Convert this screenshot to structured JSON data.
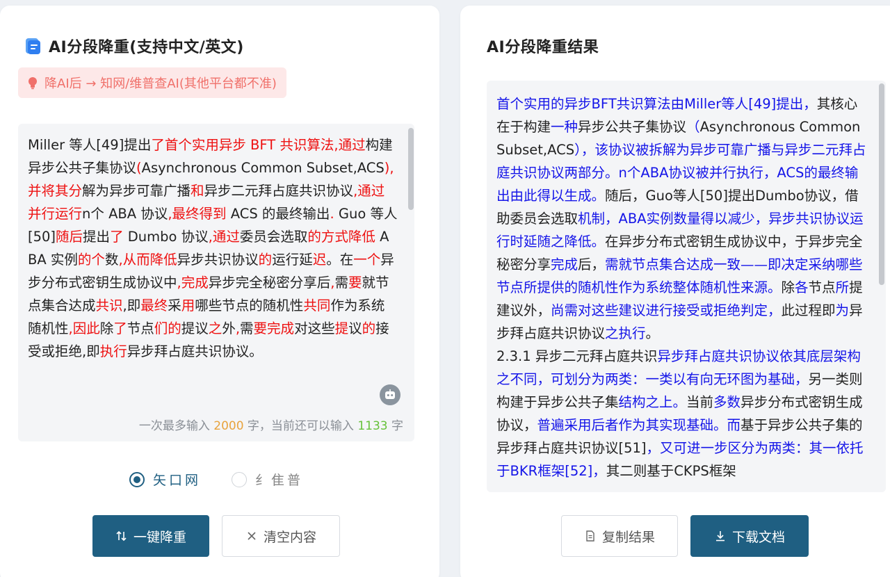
{
  "left": {
    "title": "AI分段降重(支持中文/英文)",
    "notice": "降AI后 → 知网/维普查AI(其他平台都不准)",
    "input_segments": [
      {
        "t": "Miller 等人[49]提出",
        "h": false
      },
      {
        "t": "了首个实用异步 BFT 共识算法,通过",
        "h": true
      },
      {
        "t": "构建异步公共子集协议",
        "h": false
      },
      {
        "t": "(",
        "h": true
      },
      {
        "t": "Asynchronous Common Subset,ACS",
        "h": false
      },
      {
        "t": "),并将其分",
        "h": true
      },
      {
        "t": "解为异步可靠广播",
        "h": false
      },
      {
        "t": "和",
        "h": true
      },
      {
        "t": "异步二元拜占庭共识协议",
        "h": false
      },
      {
        "t": ",通过并行运行",
        "h": true
      },
      {
        "t": "n个 ABA 协议",
        "h": false
      },
      {
        "t": ",最终得到",
        "h": true
      },
      {
        "t": " ACS 的最终输出",
        "h": false
      },
      {
        "t": ". ",
        "h": true
      },
      {
        "t": "Guo 等人[50]",
        "h": false
      },
      {
        "t": "随后",
        "h": true
      },
      {
        "t": "提出",
        "h": false
      },
      {
        "t": "了",
        "h": true
      },
      {
        "t": " Dumbo 协议",
        "h": false
      },
      {
        "t": ",通过",
        "h": true
      },
      {
        "t": "委员会选取",
        "h": false
      },
      {
        "t": "的方式降低",
        "h": true
      },
      {
        "t": " ABA 实例",
        "h": false
      },
      {
        "t": "的个",
        "h": true
      },
      {
        "t": "数",
        "h": false
      },
      {
        "t": ",从而降低",
        "h": true
      },
      {
        "t": "异步共识协议",
        "h": false
      },
      {
        "t": "的",
        "h": true
      },
      {
        "t": "运行延",
        "h": false
      },
      {
        "t": "迟",
        "h": true
      },
      {
        "t": "。在",
        "h": false
      },
      {
        "t": "一个",
        "h": true
      },
      {
        "t": "异步分布式密钥生成协议中",
        "h": false
      },
      {
        "t": ",完成",
        "h": true
      },
      {
        "t": "异步完全秘密分享后",
        "h": false
      },
      {
        "t": ",",
        "h": true
      },
      {
        "t": "需",
        "h": false
      },
      {
        "t": "要",
        "h": true
      },
      {
        "t": "就节点集合达成",
        "h": false
      },
      {
        "t": "共识",
        "h": true
      },
      {
        "t": ",",
        "h": false
      },
      {
        "t": "即",
        "h": false
      },
      {
        "t": "最终",
        "h": true
      },
      {
        "t": "采",
        "h": false
      },
      {
        "t": "用",
        "h": true
      },
      {
        "t": "哪些节点的随机性",
        "h": false
      },
      {
        "t": "共同",
        "h": true
      },
      {
        "t": "作为系统随机性",
        "h": false
      },
      {
        "t": ",因此",
        "h": true
      },
      {
        "t": "除",
        "h": false
      },
      {
        "t": "了",
        "h": true
      },
      {
        "t": "节点",
        "h": false
      },
      {
        "t": "们的",
        "h": true
      },
      {
        "t": "提议",
        "h": false
      },
      {
        "t": "之",
        "h": true
      },
      {
        "t": "外",
        "h": false
      },
      {
        "t": ",",
        "h": true
      },
      {
        "t": "需",
        "h": false
      },
      {
        "t": "要完成",
        "h": true
      },
      {
        "t": "对这些",
        "h": false
      },
      {
        "t": "提",
        "h": true
      },
      {
        "t": "议",
        "h": false
      },
      {
        "t": "的",
        "h": true
      },
      {
        "t": "接受或拒绝",
        "h": false
      },
      {
        "t": ",",
        "h": false
      },
      {
        "t": "即",
        "h": false
      },
      {
        "t": "执行",
        "h": true
      },
      {
        "t": "异步拜占庭共识协议。",
        "h": false
      }
    ],
    "counter": {
      "prefix": "一次最多输入 ",
      "max": "2000",
      "middle": " 字，当前还可以输入 ",
      "remaining": "1133",
      "suffix": " 字"
    },
    "radios": [
      {
        "label": "矢口网",
        "checked": true
      },
      {
        "label": "纟隹普",
        "checked": false
      }
    ],
    "buttons": {
      "rewrite": "一键降重",
      "clear": "清空内容"
    }
  },
  "right": {
    "title": "AI分段降重结果",
    "result_segments": [
      {
        "t": "首个实用的异步BFT共识算法由Miller等人[49]提出，",
        "b": true
      },
      {
        "t": "其核心在于构建",
        "b": false
      },
      {
        "t": "一种",
        "b": true
      },
      {
        "t": "异步公共子集协议",
        "b": false
      },
      {
        "t": "（",
        "b": true
      },
      {
        "t": "Asynchronous Common Subset,ACS",
        "b": false
      },
      {
        "t": "），该协议被拆解为异步可靠广播与异步二元拜占庭共识协议两部分。n个ABA协议被并行执行，ACS的最终输出由此得以生成。",
        "b": true
      },
      {
        "t": "随后，Guo等人[50]提出Dumbo协议，借助委员会选取",
        "b": false
      },
      {
        "t": "机制，ABA实例数量得以减少，异步共识协议运行时延随之降低。",
        "b": true
      },
      {
        "t": "在异步分布式密钥生成协议中，",
        "b": false
      },
      {
        "t": "于异步完全秘密分享",
        "b": false
      },
      {
        "t": "完成",
        "b": true
      },
      {
        "t": "后，",
        "b": false
      },
      {
        "t": "需就节点集合达成一致——即决定采纳哪些节点所提供的随机性作为系统整体随机性来源。",
        "b": true
      },
      {
        "t": "除",
        "b": false
      },
      {
        "t": "各",
        "b": true
      },
      {
        "t": "节点",
        "b": false
      },
      {
        "t": "所",
        "b": true
      },
      {
        "t": "提建议外，",
        "b": false
      },
      {
        "t": "尚需对这些建议进行接受或拒绝判定，",
        "b": true
      },
      {
        "t": "此过程即",
        "b": false
      },
      {
        "t": "为",
        "b": true
      },
      {
        "t": "异步拜占庭共识协议",
        "b": false
      },
      {
        "t": "之执行",
        "b": true
      },
      {
        "t": "。\n2.3.1 异步二元拜占庭共识",
        "b": false
      },
      {
        "t": "异步拜占庭共识协议依其底层架构之不同，可划分为两类：一类以有向无环图为基础，",
        "b": true
      },
      {
        "t": "另一类则构建于异步公共子集",
        "b": false
      },
      {
        "t": "结构之上。",
        "b": true
      },
      {
        "t": "当前",
        "b": false
      },
      {
        "t": "多数",
        "b": true
      },
      {
        "t": "异步分布式密钥生成协议，",
        "b": false
      },
      {
        "t": "普遍采用后者作为其实现基础。而",
        "b": true
      },
      {
        "t": "基于异步公共子集的异步拜占庭共识协议[51]",
        "b": false
      },
      {
        "t": "，又可进一步区分为两类：其一依托于BKR框架[52]，",
        "b": true
      },
      {
        "t": "其二则基于CKPS框架",
        "b": false
      }
    ],
    "buttons": {
      "copy": "复制结果",
      "download": "下载文档"
    }
  },
  "colors": {
    "primary": "#1f5f82",
    "highlight_red": "#ee1111",
    "highlight_blue": "#1515e8",
    "notice_bg": "#fde8e8",
    "notice_fg": "#f0706a"
  }
}
